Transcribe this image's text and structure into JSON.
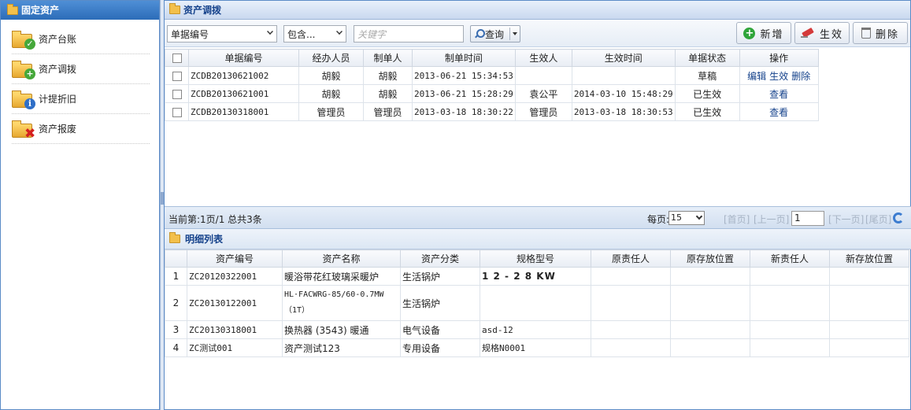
{
  "sidebar": {
    "title": "固定资产",
    "items": [
      {
        "label": "资产台账",
        "icon": "folder-check-icon"
      },
      {
        "label": "资产调拨",
        "icon": "folder-add-icon"
      },
      {
        "label": "计提折旧",
        "icon": "folder-info-icon"
      },
      {
        "label": "资产报废",
        "icon": "folder-delete-icon"
      }
    ]
  },
  "panel": {
    "title": "资产调拨"
  },
  "toolbar": {
    "field_select": "单据编号",
    "op_select": "包含...",
    "keyword_placeholder": "关键字",
    "query_label": "查询",
    "add_label": "新增",
    "effect_label": "生效",
    "delete_label": "删除"
  },
  "grid": {
    "columns": [
      "单据编号",
      "经办人员",
      "制单人",
      "制单时间",
      "生效人",
      "生效时间",
      "单据状态",
      "操作"
    ],
    "rows": [
      {
        "no": "ZCDB20130621002",
        "handler": "胡毅",
        "maker": "胡毅",
        "made_at": "2013-06-21 15:34:53",
        "effector": "",
        "effect_at": "",
        "status": "草稿",
        "actions": [
          "编辑",
          "生效",
          "删除"
        ]
      },
      {
        "no": "ZCDB20130621001",
        "handler": "胡毅",
        "maker": "胡毅",
        "made_at": "2013-06-21 15:28:29",
        "effector": "袁公平",
        "effect_at": "2014-03-10 15:48:29",
        "status": "已生效",
        "actions": [
          "查看"
        ]
      },
      {
        "no": "ZCDB20130318001",
        "handler": "管理员",
        "maker": "管理员",
        "made_at": "2013-03-18 18:30:22",
        "effector": "管理员",
        "effect_at": "2013-03-18 18:30:53",
        "status": "已生效",
        "actions": [
          "查看"
        ]
      }
    ]
  },
  "pager": {
    "info": "当前第:1页/1 总共3条",
    "page_size_label": "每页:",
    "page_size": "15",
    "first": "[首页]",
    "prev": "[上一页]",
    "page": "1",
    "next": "[下一页]",
    "last": "[尾页]"
  },
  "detail": {
    "title": "明细列表",
    "columns": [
      "资产编号",
      "资产名称",
      "资产分类",
      "规格型号",
      "原责任人",
      "原存放位置",
      "新责任人",
      "新存放位置"
    ],
    "rows": [
      {
        "idx": "1",
        "code": "ZC20120322001",
        "name": "暖浴带花红玻璃采暖炉",
        "category": "生活锅炉",
        "spec": "1 2 - 2 8 KW",
        "old_owner": "",
        "old_loc": "",
        "new_owner": "",
        "new_loc": ""
      },
      {
        "idx": "2",
        "code": "ZC20130122001",
        "name": "HL·FACWRG-85/60-0.7MW （1T）",
        "category": "生活锅炉",
        "spec": "",
        "old_owner": "",
        "old_loc": "",
        "new_owner": "",
        "new_loc": ""
      },
      {
        "idx": "3",
        "code": "ZC20130318001",
        "name": "换热器 (3543) 暖通",
        "category": "电气设备",
        "spec": "asd-12",
        "old_owner": "",
        "old_loc": "",
        "new_owner": "",
        "new_loc": ""
      },
      {
        "idx": "4",
        "code": "ZC测试001",
        "name": "资产测试123",
        "category": "专用设备",
        "spec": "规格N0001",
        "old_owner": "",
        "old_loc": "",
        "new_owner": "",
        "new_loc": ""
      }
    ]
  }
}
